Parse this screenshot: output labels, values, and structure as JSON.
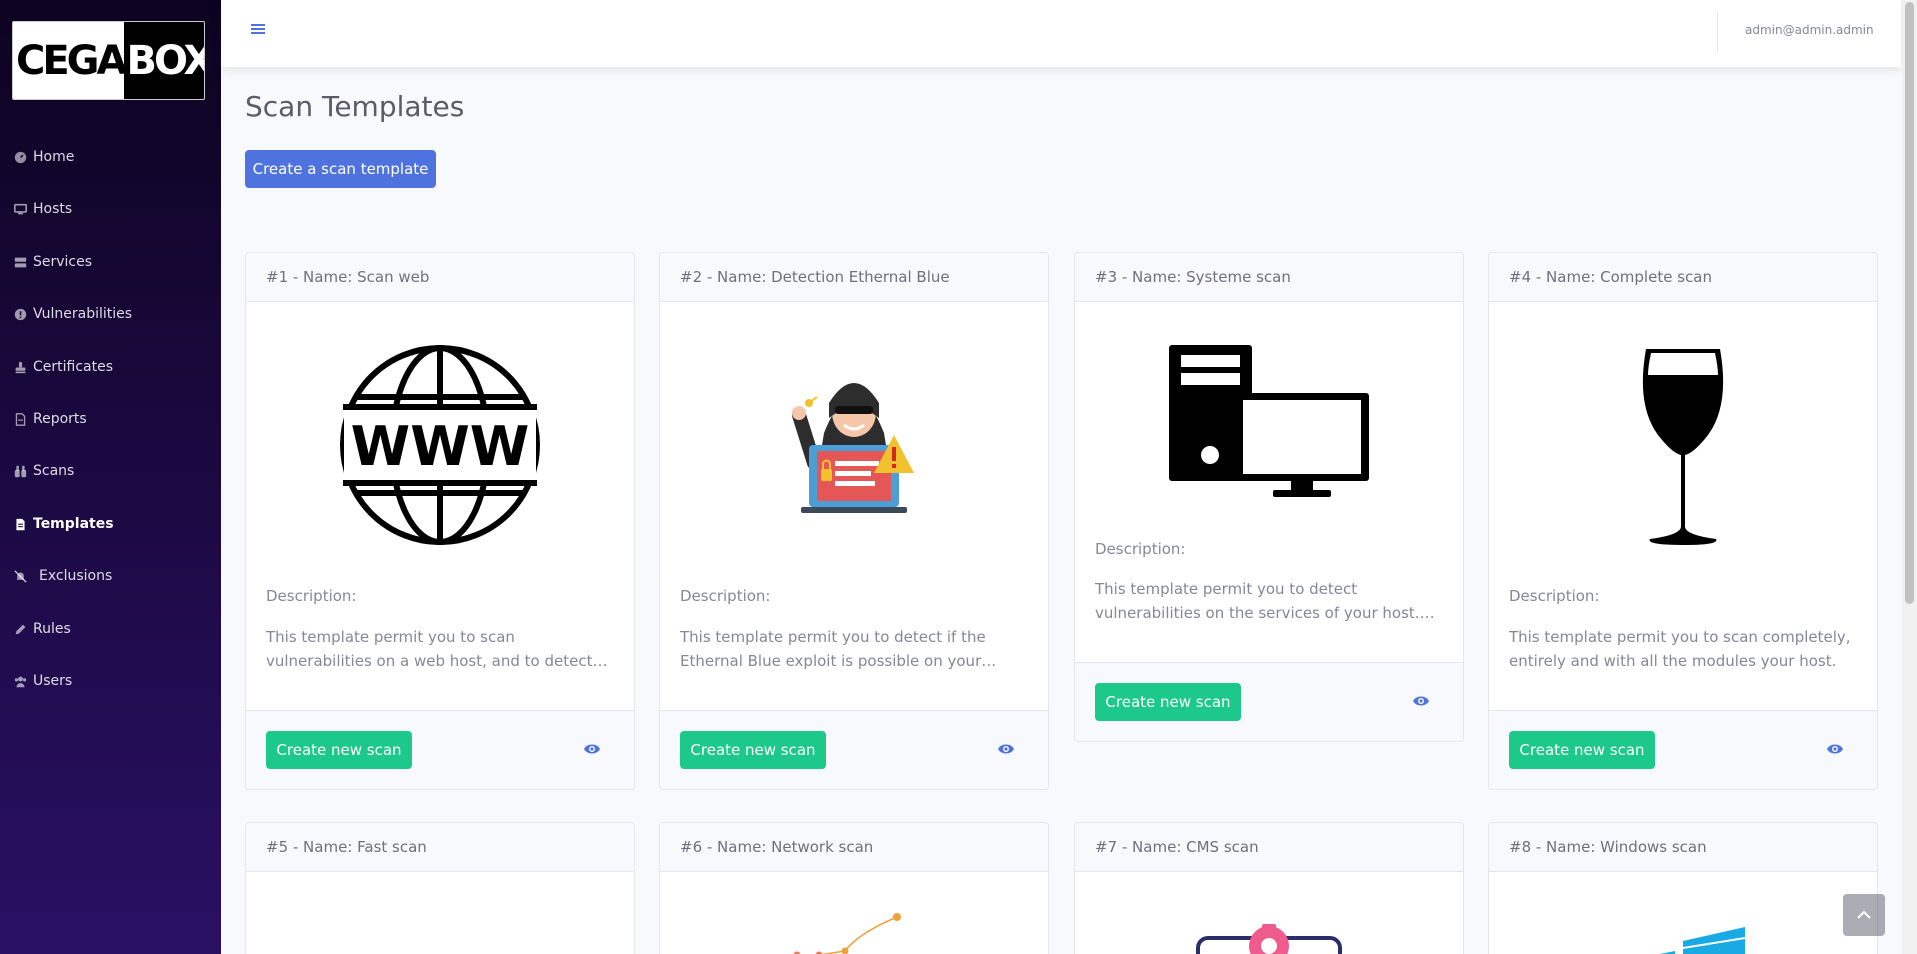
{
  "brand": {
    "part1": "CEGA",
    "part2": "BOX"
  },
  "sidebar": {
    "items": [
      {
        "label": "Home",
        "icon": "gauge-icon",
        "active": false
      },
      {
        "label": "Hosts",
        "icon": "desktop-icon",
        "active": false
      },
      {
        "label": "Services",
        "icon": "server-icon",
        "active": false
      },
      {
        "label": "Vulnerabilities",
        "icon": "exclamation-circle-icon",
        "active": false
      },
      {
        "label": "Certificates",
        "icon": "stamp-icon",
        "active": false
      },
      {
        "label": "Reports",
        "icon": "file-report-icon",
        "active": false
      },
      {
        "label": "Scans",
        "icon": "binoculars-icon",
        "active": false
      },
      {
        "label": "Templates",
        "icon": "file-icon",
        "active": true
      },
      {
        "label": "Exclusions",
        "icon": "bell-slash-icon",
        "active": false
      },
      {
        "label": "Rules",
        "icon": "pen-icon",
        "active": false
      },
      {
        "label": "Users",
        "icon": "users-icon",
        "active": false
      }
    ]
  },
  "topbar": {
    "user": "admin@admin.admin"
  },
  "page": {
    "title": "Scan Templates",
    "create_button": "Create a scan template"
  },
  "cards": [
    {
      "header": "#1 - Name: Scan web",
      "image": "www-globe-icon",
      "desc_label": "Description:",
      "desc": "This template permit you to scan vulnerabilities on a web host, and to detect certificates if you...",
      "button": "Create new scan"
    },
    {
      "header": "#2 - Name: Detection Ethernal Blue",
      "image": "hacker-laptop-icon",
      "desc_label": "Description:",
      "desc": "This template permit you to detect if the Ethernal Blue exploit is possible on your host....",
      "button": "Create new scan"
    },
    {
      "header": "#3 - Name: Systeme scan",
      "image": "desktop-computer-icon",
      "desc_label": "Description:",
      "desc": "This template permit you to detect vulnerabilities on the services of your host. It...",
      "button": "Create new scan"
    },
    {
      "header": "#4 - Name: Complete scan",
      "image": "wine-glass-icon",
      "desc_label": "Description:",
      "desc": "This template permit you to scan completely, entirely and with all the modules your host.",
      "button": "Create new scan"
    },
    {
      "header": "#5 - Name: Fast scan",
      "image": "fast-scan-icon"
    },
    {
      "header": "#6 - Name: Network scan",
      "image": "network-graph-icon"
    },
    {
      "header": "#7 - Name: CMS scan",
      "image": "cms-gear-icon"
    },
    {
      "header": "#8 - Name: Windows scan",
      "image": "windows-logo-icon"
    }
  ],
  "colors": {
    "primary": "#4e73df",
    "success": "#1cc88a",
    "sidebar_top": "#0d0320",
    "sidebar_bottom": "#2a1064"
  }
}
